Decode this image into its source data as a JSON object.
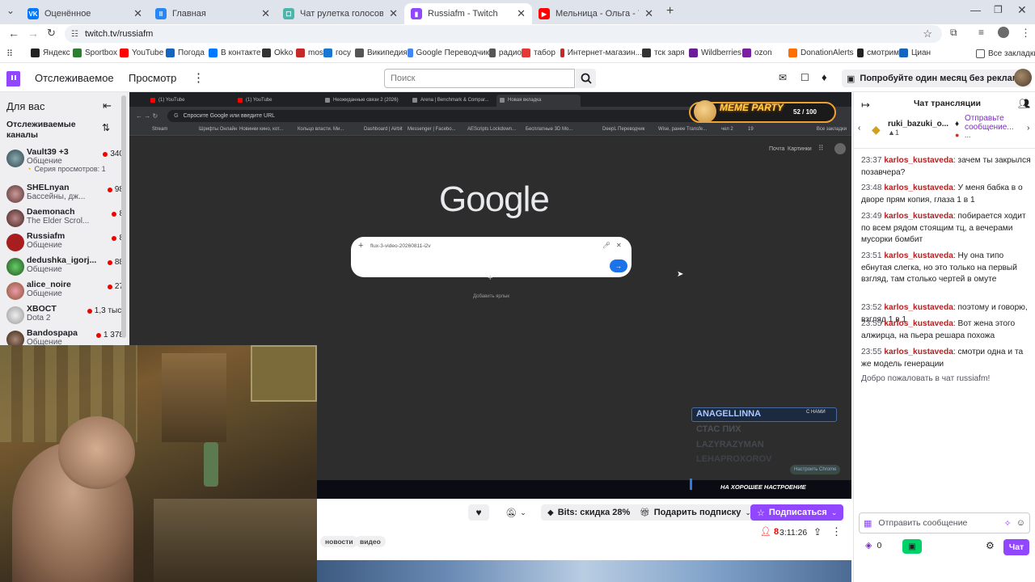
{
  "browser": {
    "tabs": [
      {
        "title": "Оценённое",
        "color": "#0077ff",
        "glyph": "VK"
      },
      {
        "title": "Главная",
        "color": "#2787f5",
        "glyph": "II"
      },
      {
        "title": "Чат рулетка голосовая — Nek",
        "color": "#4db6ac",
        "glyph": "☐"
      },
      {
        "title": "Russiafm - Twitch",
        "color": "#9146ff",
        "glyph": "▮"
      },
      {
        "title": "Мельница - Ольга - YouTube",
        "color": "#ff0000",
        "glyph": "▶"
      }
    ],
    "address": "twitch.tv/russiafm",
    "bookmarks": [
      "Яндекс",
      "Sportbox",
      "YouTube",
      "Погода",
      "В контакте",
      "Okko",
      "mos",
      "госу",
      "Википедия",
      "Google Переводчик",
      "радио",
      "табор",
      "Интернет-магазин...",
      "тск заря",
      "Wildberries",
      "ozon",
      "DonationAlerts",
      "смотрим",
      "Циан"
    ],
    "all_bookmarks": "Все закладки"
  },
  "twitch": {
    "nav_following": "Отслеживаемое",
    "nav_browse": "Просмотр",
    "search_placeholder": "Поиск",
    "ad_free": "Попробуйте один месяц без рекламы"
  },
  "sidebar": {
    "title": "Для вас",
    "section": "Отслеживаемые каналы",
    "channels": [
      {
        "name": "Vault39 +3",
        "game": "Общение",
        "viewers": "340",
        "extra": "Серия просмотров: 1"
      },
      {
        "name": "SHELnyan",
        "game": "Бассейны, дж...",
        "viewers": "98"
      },
      {
        "name": "Daemonach",
        "game": "The Elder Scrol...",
        "viewers": "8"
      },
      {
        "name": "Russiafm",
        "game": "Общение",
        "viewers": "8"
      },
      {
        "name": "dedushka_igorj...",
        "game": "Общение",
        "viewers": "88"
      },
      {
        "name": "alice_noire",
        "game": "Общение",
        "viewers": "27"
      },
      {
        "name": "XBOCT",
        "game": "Dota 2",
        "viewers": "1,3 тыс."
      },
      {
        "name": "Bandospapa",
        "game": "Общение",
        "viewers": "1 378"
      }
    ]
  },
  "stream": {
    "inner_tabs": [
      "(1) YouTube",
      "(1) YouTube",
      "Неожиданные связи 2 (2026)",
      "Arena | Benchmark & Compar...",
      "Новая вкладка"
    ],
    "inner_address": "Спросите Google или введите URL",
    "inner_bookmarks": [
      "Stream",
      "Шрифты Онлайн",
      "Новинки кино, кот...",
      "Кольцо власти. Ми...",
      "Dashboard | Airbit",
      "Messenger | Facebo...",
      "AEScripts Lockdown...",
      "Бесплатные 3D Мо...",
      "DeepL Переводчик",
      "Wise, ранее Transfe...",
      "чел 2",
      "19"
    ],
    "inner_all": "Все закладки",
    "google_links": [
      "Почта",
      "Картинки"
    ],
    "google_logo": "Google",
    "search_text": "flux-3-video-20260811-i2v",
    "add_shortcut": "Добавить ярлык",
    "meme_party": "MEME PARTY",
    "meme_counter": "52 / 100",
    "overlay_users": [
      "ANAGELLINNA",
      "СТАС ПИХ",
      "LAZYRAZYMAN",
      "LEHAPROXOROV"
    ],
    "overlay_tag": "С НАМИ",
    "overlay_customize": "Настроить Chrome",
    "banner": "НА ХОРОШЕЕ НАСТРОЕНИЕ"
  },
  "info": {
    "bits": "Bits: скидка 28%",
    "gift": "Подарить подписку",
    "subscribe": "Подписаться",
    "tags": [
      "новости",
      "видео"
    ],
    "viewers": "8",
    "uptime": "3:11:26"
  },
  "chat": {
    "title": "Чат трансляции",
    "pinned_user": "ruki_bazuki_o...",
    "pinned_count": "1",
    "pinned_send": "Отправьте сообщение...",
    "messages": [
      {
        "time": "23:37",
        "user": "karlos_kustaveda",
        "text": "зачем ты закрылся позавчера?"
      },
      {
        "time": "23:48",
        "user": "karlos_kustaveda",
        "text": "У меня бабка в о дворе прям копия, глаза 1 в 1"
      },
      {
        "time": "23:49",
        "user": "karlos_kustaveda",
        "text": "побирается ходит по всем рядом стоящим тц, а вечерами мусорки бомбит"
      },
      {
        "time": "23:51",
        "user": "karlos_kustaveda",
        "text": "Ну она типо ебнутая слегка, но это только на первый взгляд, там столько чертей в омуте"
      },
      {
        "time": "23:52",
        "user": "karlos_kustaveda",
        "text": "поэтому и говорю, взгляд 1 в 1"
      },
      {
        "time": "23:55",
        "user": "karlos_kustaveda",
        "text": "Вот жена этого алжирца, на пьера решара похожа"
      },
      {
        "time": "23:55",
        "user": "karlos_kustaveda",
        "text": "смотри одна и та же модель генерации"
      }
    ],
    "welcome": "Добро пожаловать в чат russiafm!",
    "input_placeholder": "Отправить сообщение",
    "points": "0",
    "send": "Чат"
  }
}
